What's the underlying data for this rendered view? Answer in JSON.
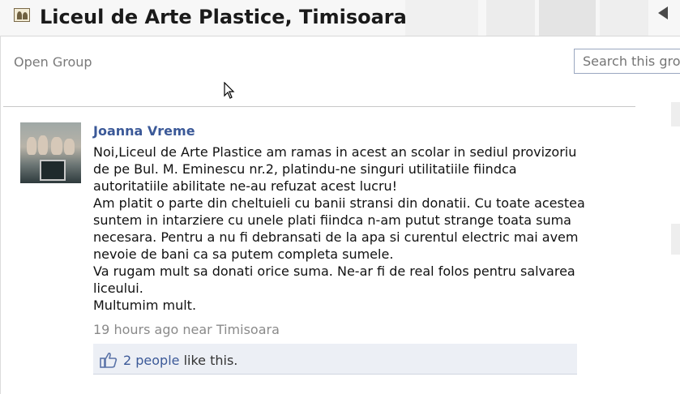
{
  "header": {
    "title": "Liceul de Arte Plastice, Timisoara",
    "group_type": "Open Group"
  },
  "search": {
    "placeholder": "Search this group"
  },
  "post": {
    "author": "Joanna Vreme",
    "lines": [
      "Noi,Liceul de Arte Plastice am ramas in acest an scolar in sediul provizoriu",
      "de pe Bul. M. Eminescu nr.2, platindu-ne singuri utilitatiile fiindca",
      "autoritatiile abilitate ne-au refuzat acest lucru!",
      "Am platit o parte din cheltuieli cu banii stransi din donatii. Cu toate acestea",
      "suntem in intarziere cu unele plati fiindca n-am putut strange toata suma",
      "necesara. Pentru a nu fi debransati de la apa si curentul electric mai avem",
      "nevoie de bani ca sa putem completa sumele.",
      "Va rugam mult sa donati orice suma. Ne-ar fi de real folos pentru salvarea",
      "liceului.",
      "Multumim mult."
    ],
    "time": "19 hours ago",
    "location_text": "near Timisoara",
    "likes": {
      "count_label": "2 people",
      "suffix": "like this."
    }
  },
  "colors": {
    "link": "#3b5998",
    "like_bg": "#eceff5",
    "muted": "#8a8a8a"
  },
  "icons": [
    "group-icon",
    "arrow-icon",
    "mouse-cursor-icon",
    "thumbs-up-icon"
  ]
}
